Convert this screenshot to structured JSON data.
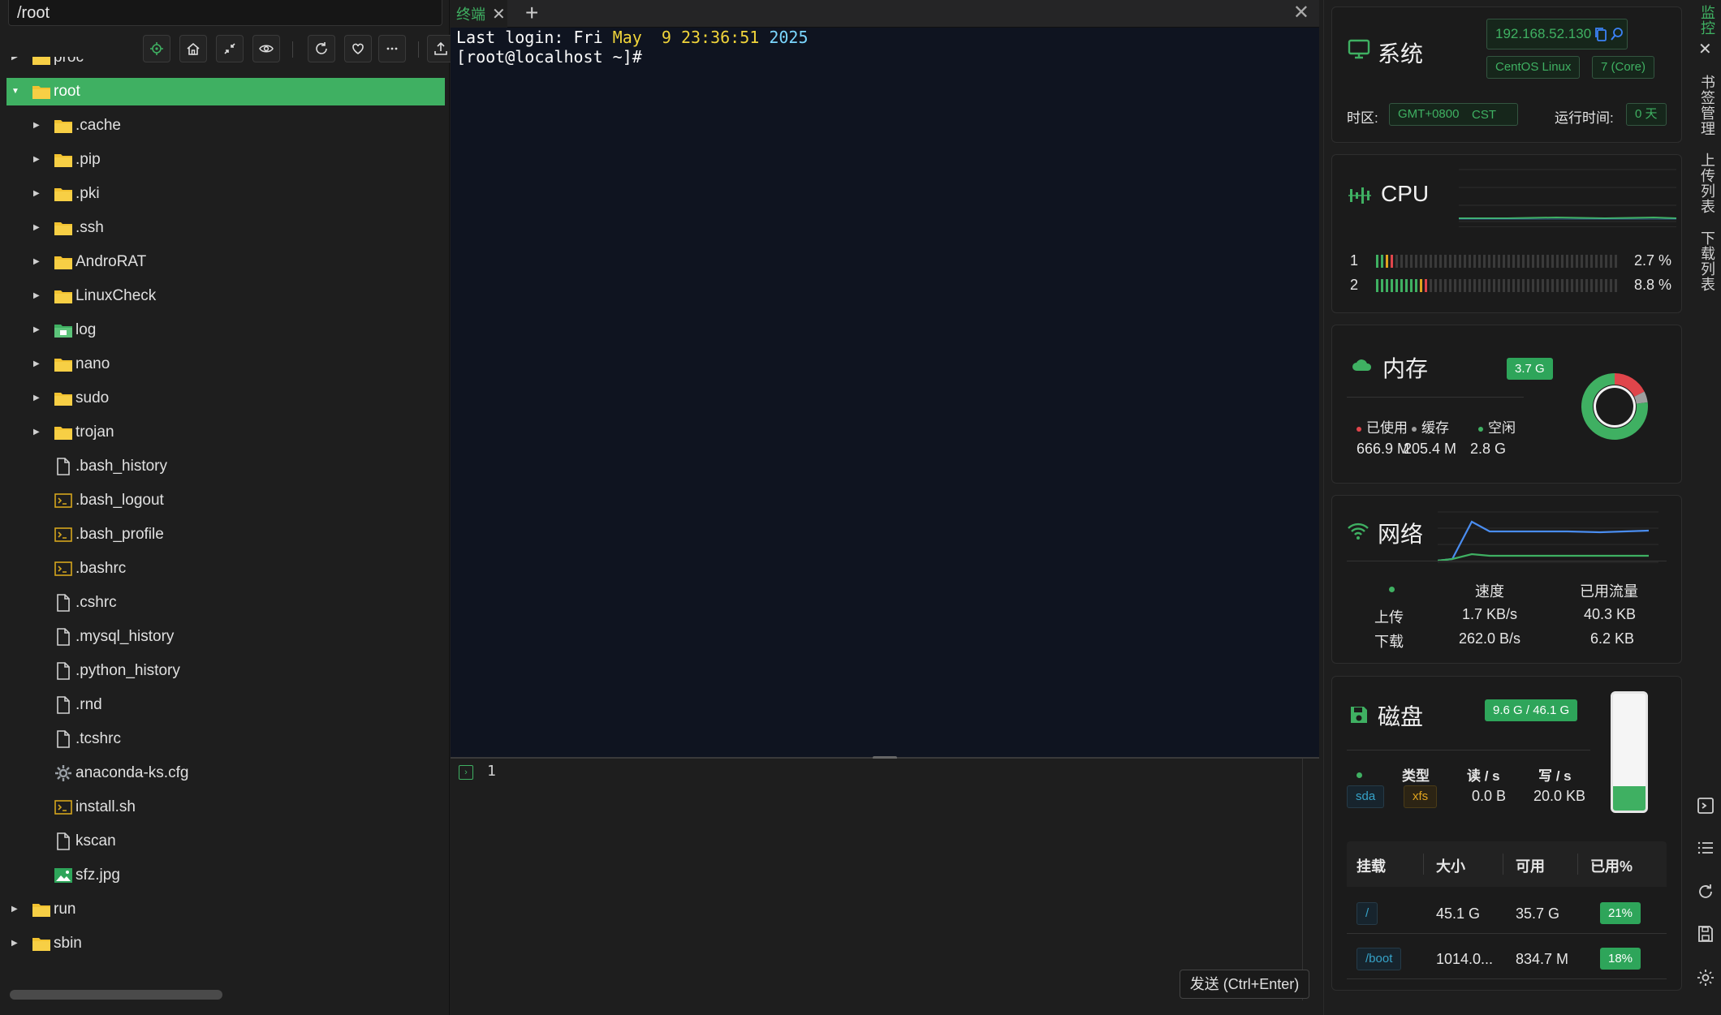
{
  "file_panel": {
    "path": "/root",
    "tree": [
      {
        "name": "proc",
        "type": "folder",
        "depth": 0,
        "expanded": false
      },
      {
        "name": "root",
        "type": "folder",
        "depth": 0,
        "expanded": true,
        "selected": true
      },
      {
        "name": ".cache",
        "type": "folder",
        "depth": 1
      },
      {
        "name": ".pip",
        "type": "folder",
        "depth": 1
      },
      {
        "name": ".pki",
        "type": "folder",
        "depth": 1
      },
      {
        "name": ".ssh",
        "type": "folder",
        "depth": 1
      },
      {
        "name": "AndroRAT",
        "type": "folder",
        "depth": 1
      },
      {
        "name": "LinuxCheck",
        "type": "folder",
        "depth": 1
      },
      {
        "name": "log",
        "type": "folder-special",
        "depth": 1
      },
      {
        "name": "nano",
        "type": "folder",
        "depth": 1
      },
      {
        "name": "sudo",
        "type": "folder",
        "depth": 1
      },
      {
        "name": "trojan",
        "type": "folder",
        "depth": 1
      },
      {
        "name": ".bash_history",
        "type": "file",
        "depth": 1
      },
      {
        "name": ".bash_logout",
        "type": "script",
        "depth": 1
      },
      {
        "name": ".bash_profile",
        "type": "script",
        "depth": 1
      },
      {
        "name": ".bashrc",
        "type": "script",
        "depth": 1
      },
      {
        "name": ".cshrc",
        "type": "file",
        "depth": 1
      },
      {
        "name": ".mysql_history",
        "type": "file",
        "depth": 1
      },
      {
        "name": ".python_history",
        "type": "file",
        "depth": 1
      },
      {
        "name": ".rnd",
        "type": "file",
        "depth": 1
      },
      {
        "name": ".tcshrc",
        "type": "file",
        "depth": 1
      },
      {
        "name": "anaconda-ks.cfg",
        "type": "config",
        "depth": 1
      },
      {
        "name": "install.sh",
        "type": "script",
        "depth": 1
      },
      {
        "name": "kscan",
        "type": "file",
        "depth": 1
      },
      {
        "name": "sfz.jpg",
        "type": "image",
        "depth": 1
      },
      {
        "name": "run",
        "type": "folder",
        "depth": 0
      },
      {
        "name": "sbin",
        "type": "folder",
        "depth": 0
      }
    ]
  },
  "terminal": {
    "tab_label": "终端",
    "login_prefix": "Last login: Fri ",
    "login_month": "May",
    "login_day": "  9 ",
    "login_time": "23:36:51",
    "login_year": "2025",
    "prompt": "[root@localhost ~]#",
    "editor_line": "1",
    "send_label": "发送 (Ctrl+Enter)"
  },
  "system": {
    "title": "系统",
    "ip": "192.168.52.130",
    "os": "CentOS Linux",
    "version": "7 (Core)",
    "tz_label": "时区:",
    "tz_value": "GMT+0800",
    "tz_abbr": "CST",
    "uptime_label": "运行时间:",
    "uptime_value": "0 天"
  },
  "cpu": {
    "title": "CPU",
    "cores": [
      {
        "id": "1",
        "percent": "2.7 %",
        "level": 2.7
      },
      {
        "id": "2",
        "percent": "8.8 %",
        "level": 8.8
      }
    ]
  },
  "memory": {
    "title": "内存",
    "total": "3.7 G",
    "legend": [
      {
        "label": "已使用",
        "value": "666.9 M",
        "color": "#e0454b"
      },
      {
        "label": "缓存",
        "value": "205.4 M",
        "color": "#9e9e9e"
      },
      {
        "label": "空闲",
        "value": "2.8 G",
        "color": "#3fb062"
      }
    ],
    "used_fraction": 0.176,
    "cache_fraction": 0.054
  },
  "network": {
    "title": "网络",
    "col_speed": "速度",
    "col_used": "已用流量",
    "rows": [
      {
        "label": "上传",
        "speed": "1.7 KB/s",
        "used": "40.3 KB"
      },
      {
        "label": "下载",
        "speed": "262.0 B/s",
        "used": "6.2 KB"
      }
    ]
  },
  "disk": {
    "title": "磁盘",
    "usage": "9.6 G / 46.1 G",
    "used_fraction": 0.21,
    "col_type": "类型",
    "col_read": "读 / s",
    "col_write": "写 / s",
    "device": "sda",
    "fs": "xfs",
    "read": "0.0 B",
    "write": "20.0 KB",
    "table_headers": [
      "挂载",
      "大小",
      "可用",
      "已用%"
    ],
    "mounts": [
      {
        "mount": "/",
        "size": "45.1 G",
        "avail": "35.7 G",
        "used": "21%"
      },
      {
        "mount": "/boot",
        "size": "1014.0...",
        "avail": "834.7 M",
        "used": "18%"
      }
    ]
  },
  "sidebar": {
    "tabs": [
      "监控",
      "书签管理",
      "上传列表",
      "下载列表"
    ]
  }
}
